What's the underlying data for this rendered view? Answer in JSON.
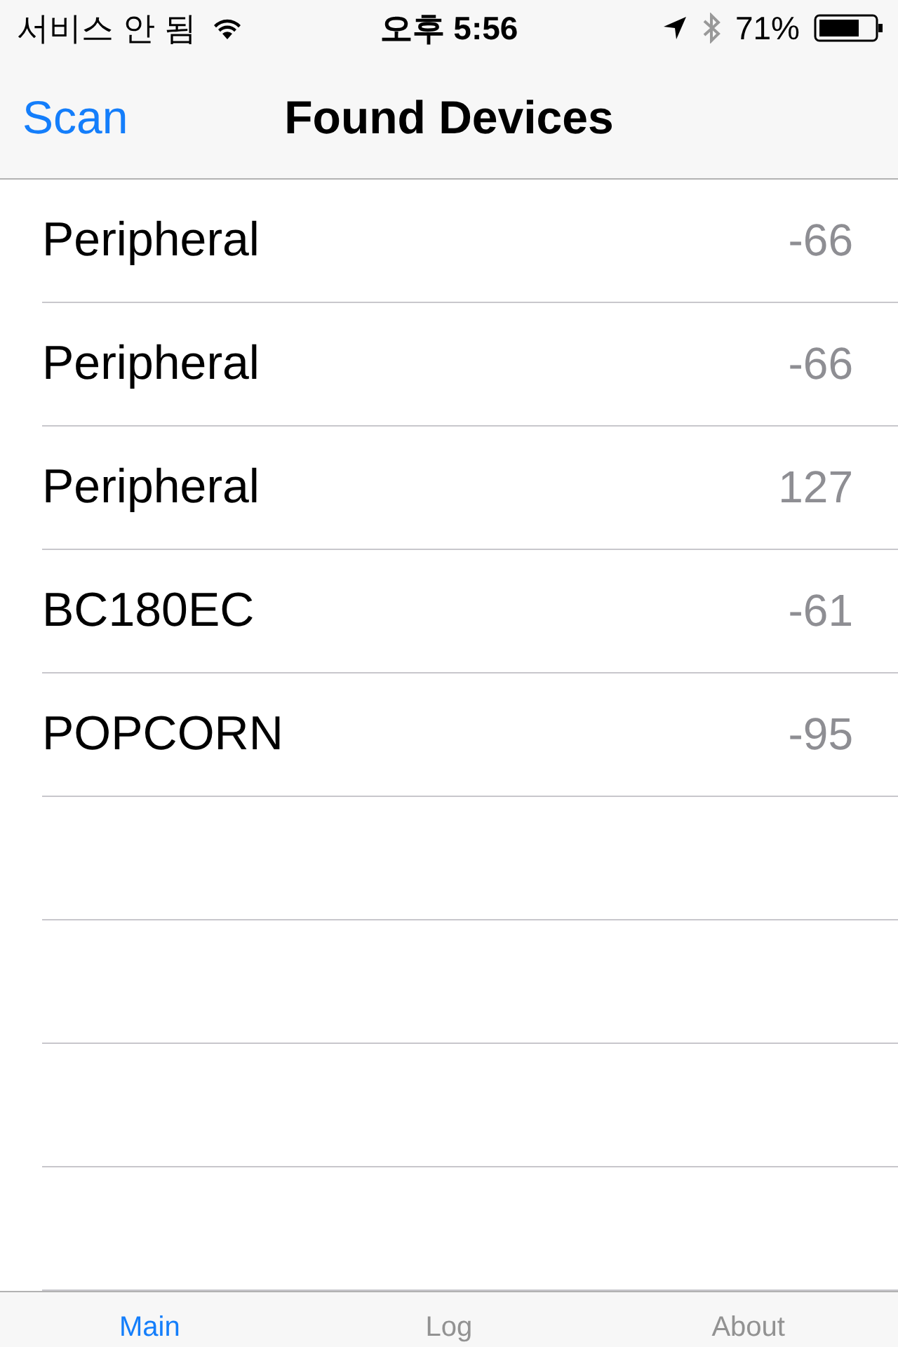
{
  "status_bar": {
    "carrier": "서비스 안 됨",
    "time": "오후 5:56",
    "battery": "71%"
  },
  "nav_bar": {
    "left_button": "Scan",
    "title": "Found Devices"
  },
  "devices": [
    {
      "name": "Peripheral",
      "rssi": "-66"
    },
    {
      "name": "Peripheral",
      "rssi": "-66"
    },
    {
      "name": "Peripheral",
      "rssi": "127"
    },
    {
      "name": "BC180EC",
      "rssi": "-61"
    },
    {
      "name": "POPCORN",
      "rssi": "-95"
    }
  ],
  "tabs": [
    {
      "label": "Main",
      "selected": true
    },
    {
      "label": "Log",
      "selected": false
    },
    {
      "label": "About",
      "selected": false
    }
  ]
}
